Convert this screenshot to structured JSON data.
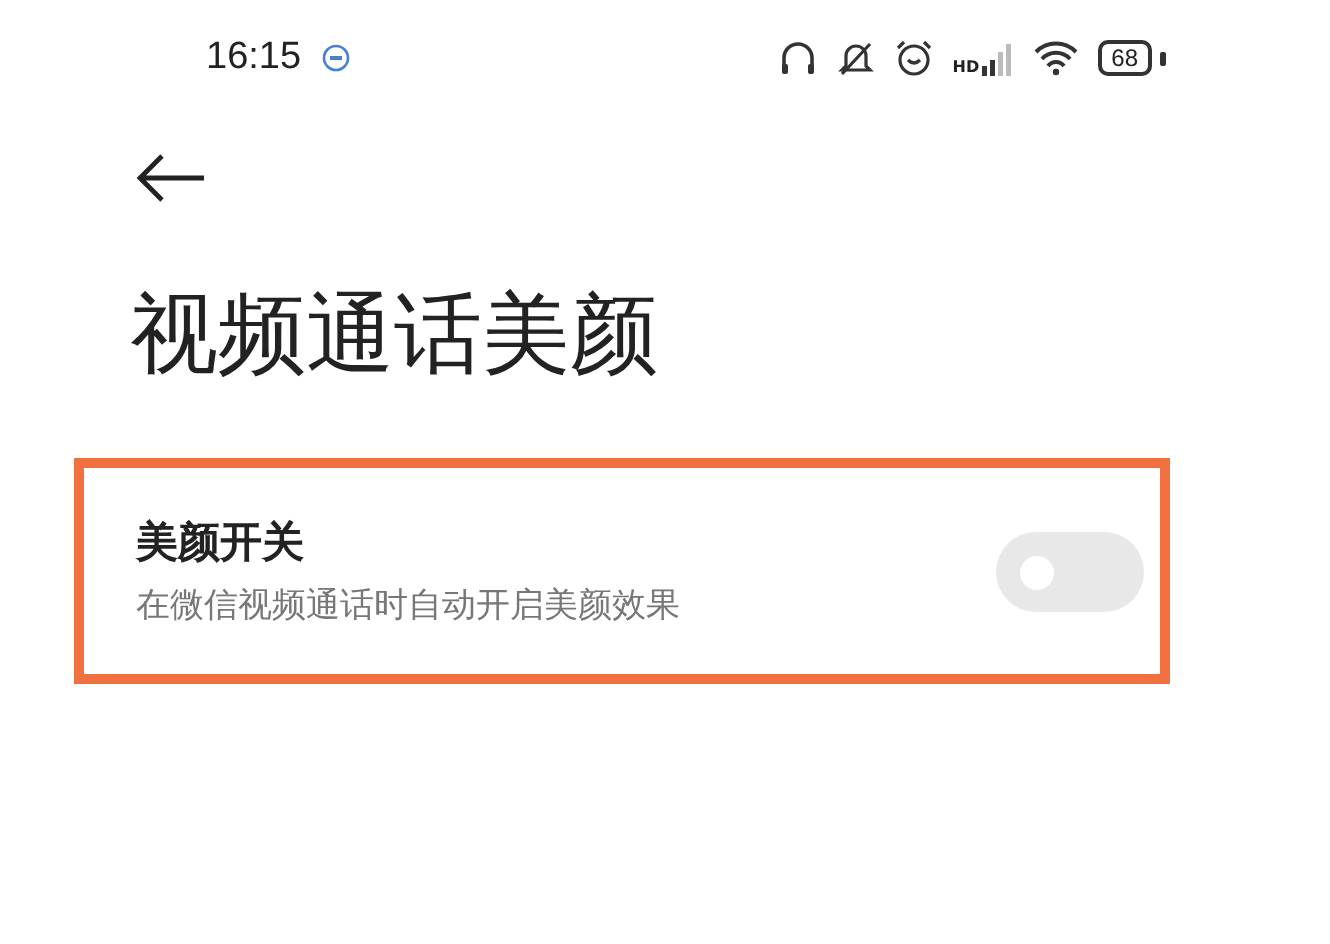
{
  "status_bar": {
    "time": "16:15",
    "network_label": "HD",
    "battery": "68"
  },
  "title": "视频通话美颜",
  "setting": {
    "label": "美颜开关",
    "description": "在微信视频通话时自动开启美颜效果",
    "on": false,
    "highlighted": true
  }
}
